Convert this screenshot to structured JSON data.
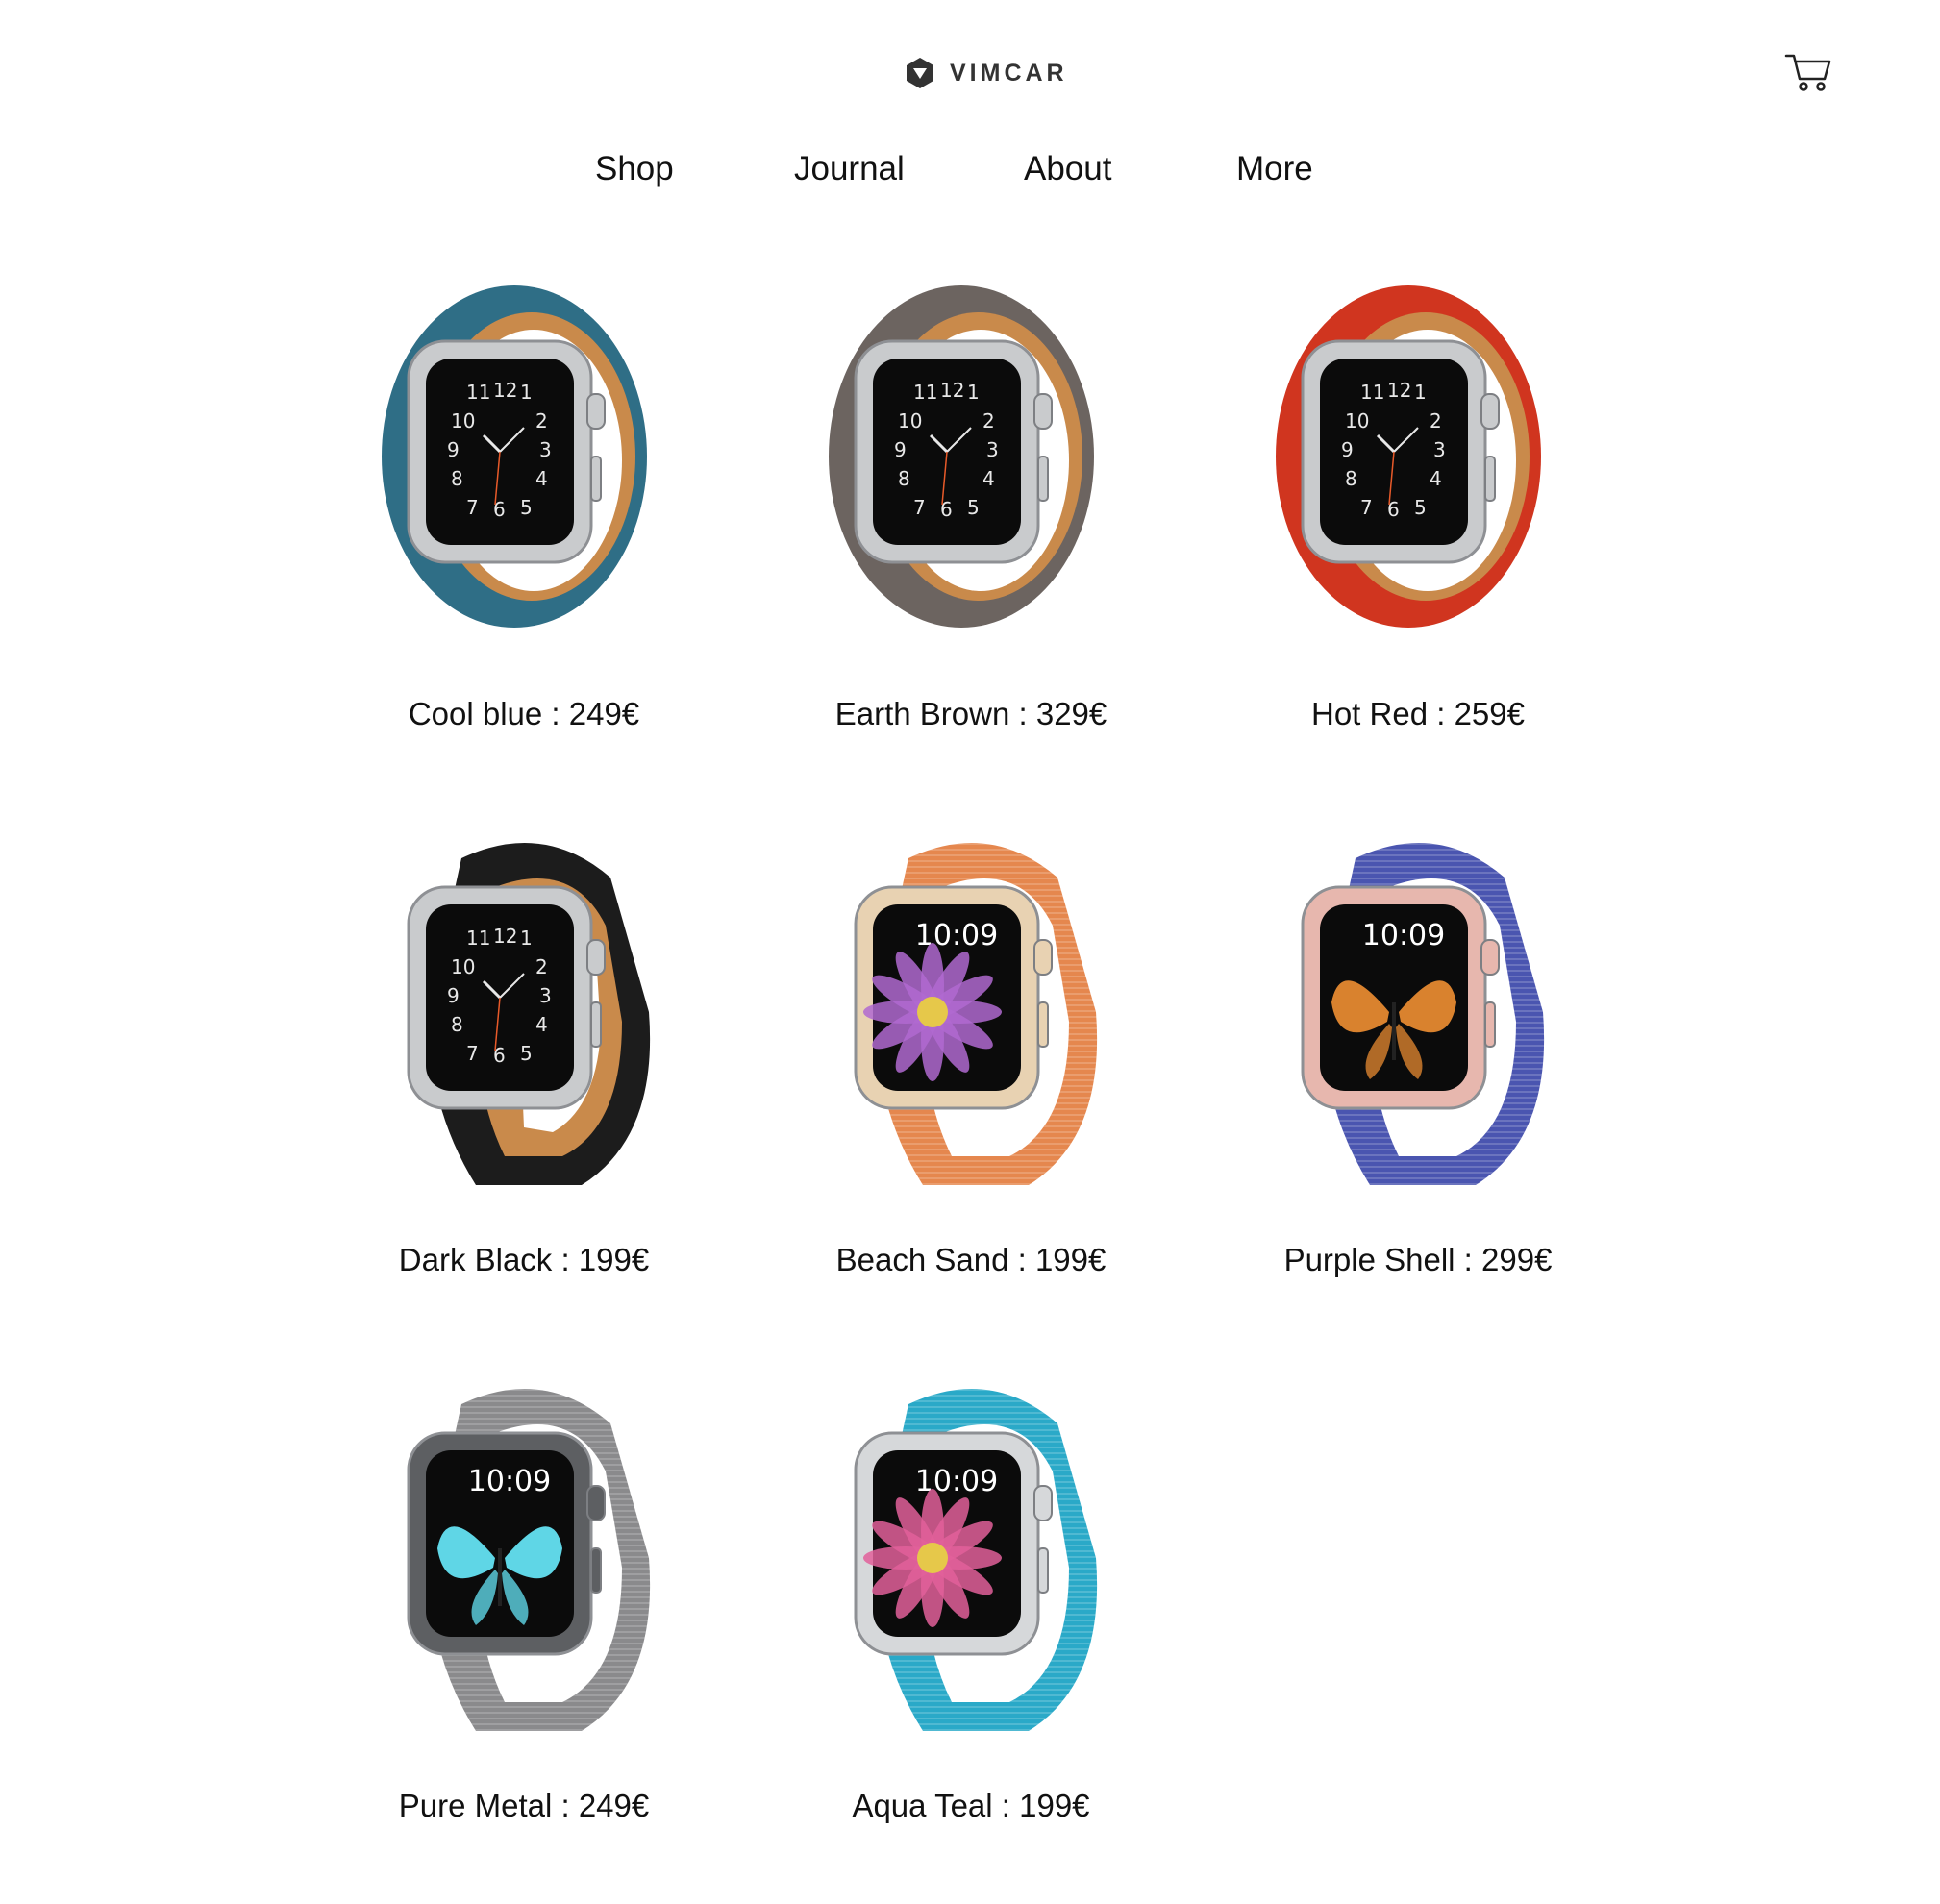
{
  "header": {
    "brand": "VIMCAR",
    "logo_icon": "vimcar-hexagon-logo",
    "cart_icon": "shopping-cart-icon"
  },
  "nav": {
    "items": [
      {
        "label": "Shop"
      },
      {
        "label": "Journal"
      },
      {
        "label": "About"
      },
      {
        "label": "More"
      }
    ]
  },
  "products": [
    {
      "caption": "Cool blue : 249€",
      "name": "Cool blue",
      "price": "249€",
      "band_style": "leather double tour",
      "band_color": "#2f6e86",
      "case_color": "#c9cbcd",
      "face": "hermes"
    },
    {
      "caption": "Earth Brown : 329€",
      "name": "Earth Brown",
      "price": "329€",
      "band_style": "leather double tour",
      "band_color": "#6c6460",
      "case_color": "#c9cbcd",
      "face": "hermes"
    },
    {
      "caption": "Hot Red : 259€",
      "name": "Hot Red",
      "price": "259€",
      "band_style": "leather double tour",
      "band_color": "#d0351f",
      "case_color": "#c9cbcd",
      "face": "hermes"
    },
    {
      "caption": "Dark Black : 199€",
      "name": "Dark Black",
      "price": "199€",
      "band_style": "leather single tour",
      "band_color": "#1c1c1c",
      "case_color": "#c9cbcd",
      "face": "hermes"
    },
    {
      "caption": "Beach Sand : 199€",
      "name": "Beach Sand",
      "price": "199€",
      "band_style": "woven nylon",
      "band_color": "#e5874e",
      "case_color": "#e8d2b2",
      "face": "flower",
      "face_time": "10:09"
    },
    {
      "caption": "Purple Shell : 299€",
      "name": "Purple Shell",
      "price": "299€",
      "band_style": "woven nylon",
      "band_color": "#4a55b0",
      "case_color": "#e7b7ae",
      "face": "butterfly",
      "face_time": "10:09"
    },
    {
      "caption": "Pure Metal : 249€",
      "name": "Pure Metal",
      "price": "249€",
      "band_style": "woven nylon",
      "band_color": "#8a8a8c",
      "case_color": "#5d5f62",
      "face": "butterfly",
      "face_time": "10:09"
    },
    {
      "caption": "Aqua Teal : 199€",
      "name": "Aqua Teal",
      "price": "199€",
      "band_style": "woven nylon",
      "band_color": "#2aa9c8",
      "case_color": "#d6d8da",
      "face": "flower",
      "face_time": "10:09"
    }
  ]
}
